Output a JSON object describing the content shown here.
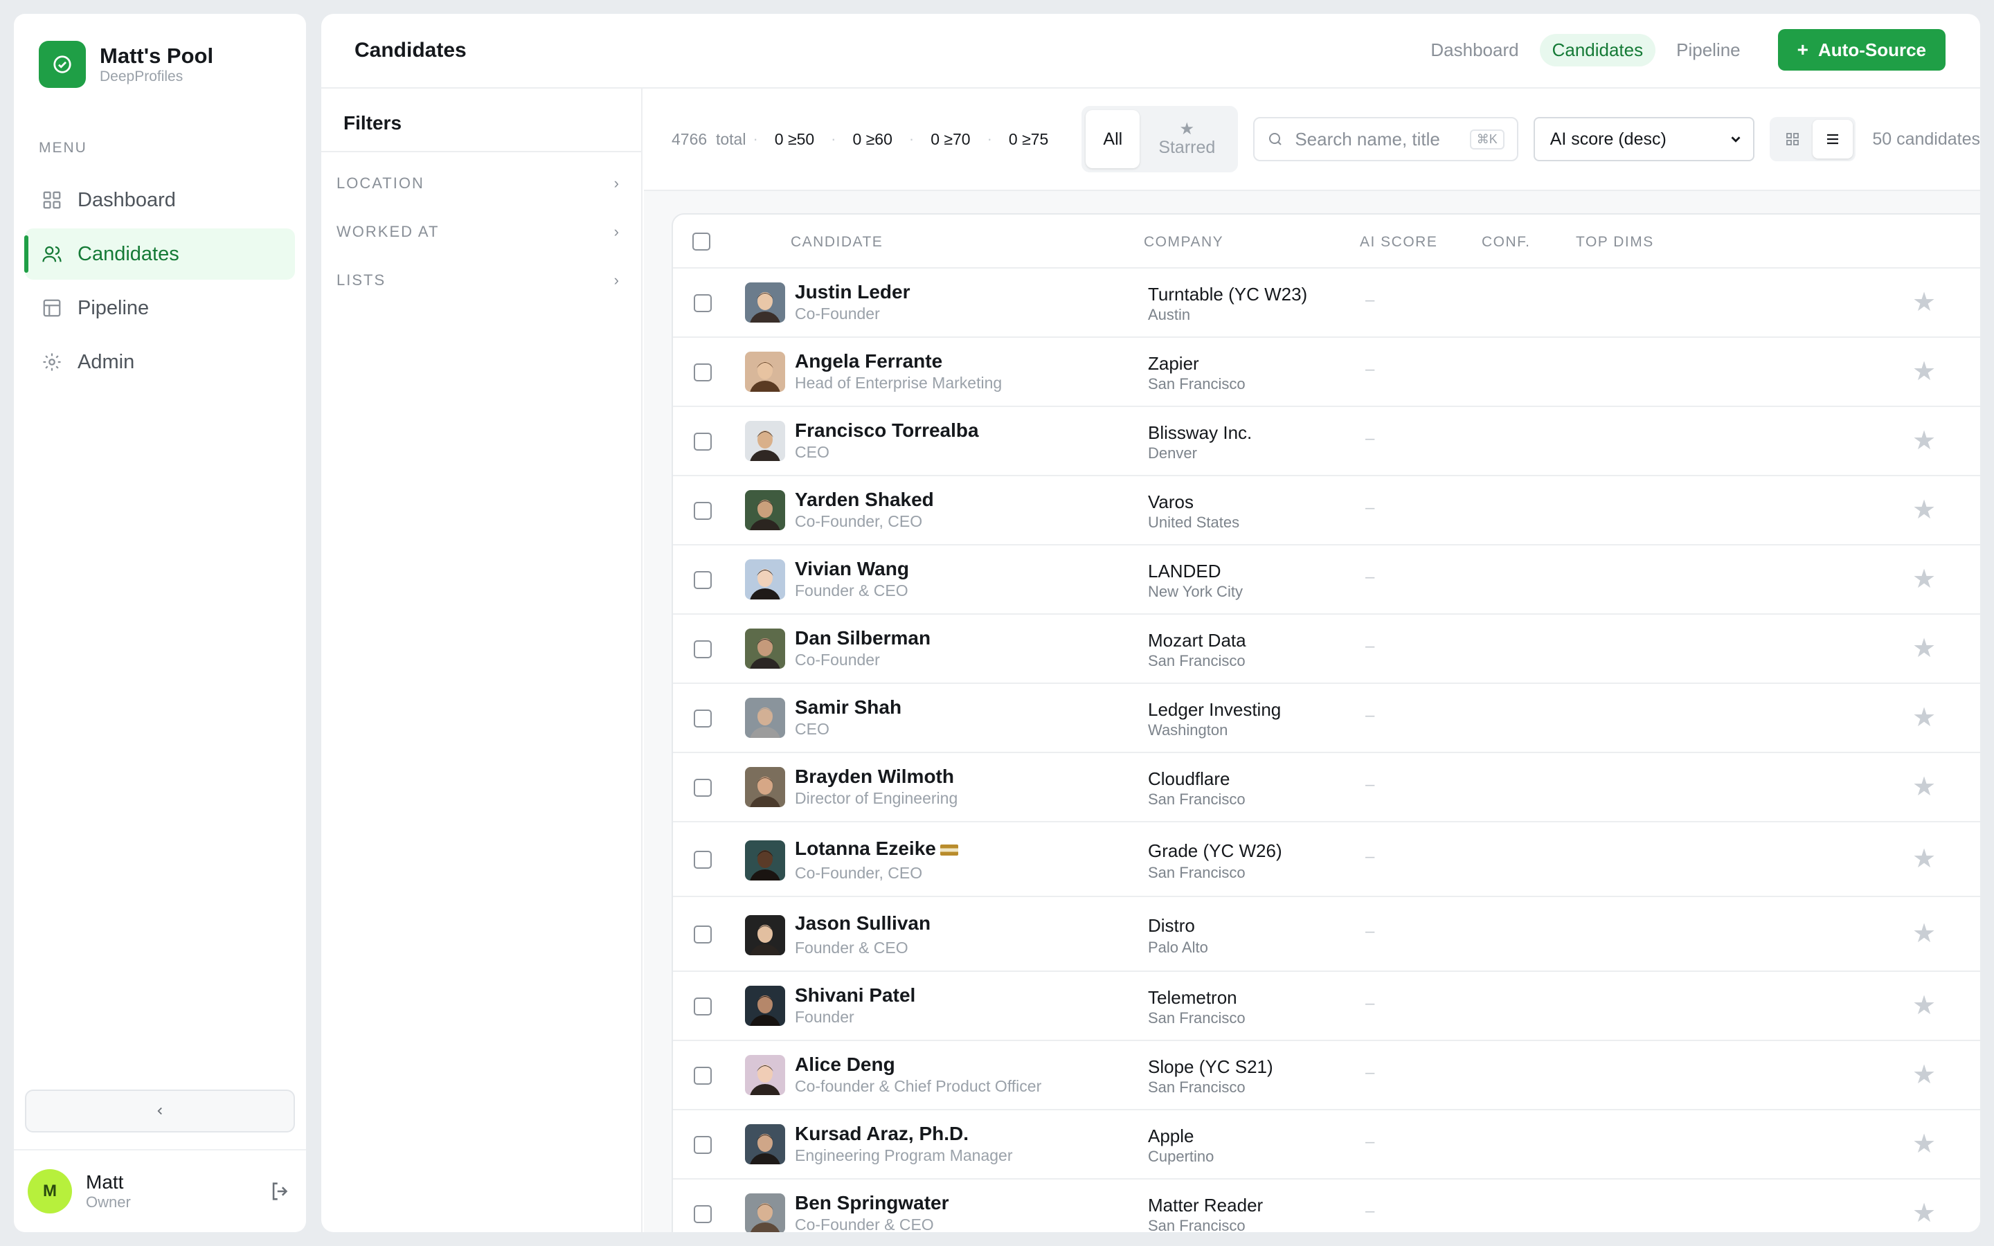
{
  "brand": {
    "title": "Matt's Pool",
    "subtitle": "DeepProfiles"
  },
  "menu_label": "MENU",
  "nav": [
    {
      "label": "Dashboard",
      "icon": "grid-icon"
    },
    {
      "label": "Candidates",
      "icon": "users-icon",
      "active": true
    },
    {
      "label": "Pipeline",
      "icon": "table-icon"
    },
    {
      "label": "Admin",
      "icon": "settings-icon"
    }
  ],
  "collapse_icon": "chevron-left-icon",
  "user": {
    "initial": "M",
    "name": "Matt",
    "role": "Owner"
  },
  "header": {
    "title": "Candidates",
    "links": [
      "Dashboard",
      "Candidates",
      "Pipeline"
    ],
    "active_link": "Candidates",
    "cta": "Auto-Source"
  },
  "filters": {
    "title": "Filters",
    "sections": [
      "LOCATION",
      "WORKED AT",
      "LISTS"
    ]
  },
  "toolbar": {
    "total": "4766",
    "total_label": "total",
    "score_chips": [
      "0 ≥50",
      "0 ≥60",
      "0 ≥70",
      "0 ≥75"
    ],
    "segment_all": "All",
    "segment_starred": "Starred",
    "search_placeholder": "Search name, title",
    "search_shortcut": "⌘K",
    "sort_value": "AI score (desc)",
    "count_text": "50 candidates"
  },
  "table": {
    "columns": {
      "candidate": "CANDIDATE",
      "company": "COMPANY",
      "ai_score": "AI SCORE",
      "conf": "CONF.",
      "top_dims": "TOP DIMS"
    },
    "rows": [
      {
        "name": "Justin Leder",
        "title": "Co-Founder",
        "company": "Turntable (YC W23)",
        "location": "Austin",
        "score": "–"
      },
      {
        "name": "Angela Ferrante",
        "title": "Head of Enterprise Marketing",
        "company": "Zapier",
        "location": "San Francisco",
        "score": "–"
      },
      {
        "name": "Francisco Torrealba",
        "title": "CEO",
        "company": "Blissway Inc.",
        "location": "Denver",
        "score": "–"
      },
      {
        "name": "Yarden Shaked",
        "title": "Co-Founder, CEO",
        "company": "Varos",
        "location": "United States",
        "score": "–"
      },
      {
        "name": "Vivian Wang",
        "title": "Founder & CEO",
        "company": "LANDED",
        "location": "New York City",
        "score": "–"
      },
      {
        "name": "Dan Silberman",
        "title": "Co-Founder",
        "company": "Mozart Data",
        "location": "San Francisco",
        "score": "–"
      },
      {
        "name": "Samir Shah",
        "title": "CEO",
        "company": "Ledger Investing",
        "location": "Washington",
        "score": "–"
      },
      {
        "name": "Brayden Wilmoth",
        "title": "Director of Engineering",
        "company": "Cloudflare",
        "location": "San Francisco",
        "score": "–"
      },
      {
        "name": "Lotanna Ezeike",
        "title": "Co-Founder, CEO",
        "company": "Grade (YC W26)",
        "location": "San Francisco",
        "score": "–",
        "flag": true
      },
      {
        "name": "Jason Sullivan",
        "title": "Founder & CEO",
        "company": "Distro",
        "location": "Palo Alto",
        "score": "–"
      },
      {
        "name": "Shivani Patel",
        "title": "Founder",
        "company": "Telemetron",
        "location": "San Francisco",
        "score": "–"
      },
      {
        "name": "Alice Deng",
        "title": "Co-founder & Chief Product Officer",
        "company": "Slope (YC S21)",
        "location": "San Francisco",
        "score": "–"
      },
      {
        "name": "Kursad Araz, Ph.D.",
        "title": "Engineering Program Manager",
        "company": "Apple",
        "location": "Cupertino",
        "score": "–"
      },
      {
        "name": "Ben Springwater",
        "title": "Co-Founder & CEO",
        "company": "Matter Reader",
        "location": "San Francisco",
        "score": "–"
      }
    ]
  },
  "colors": {
    "accent": "#1f9f46",
    "accent_light": "#ecfbf0",
    "avatar": "#b7f03c"
  }
}
